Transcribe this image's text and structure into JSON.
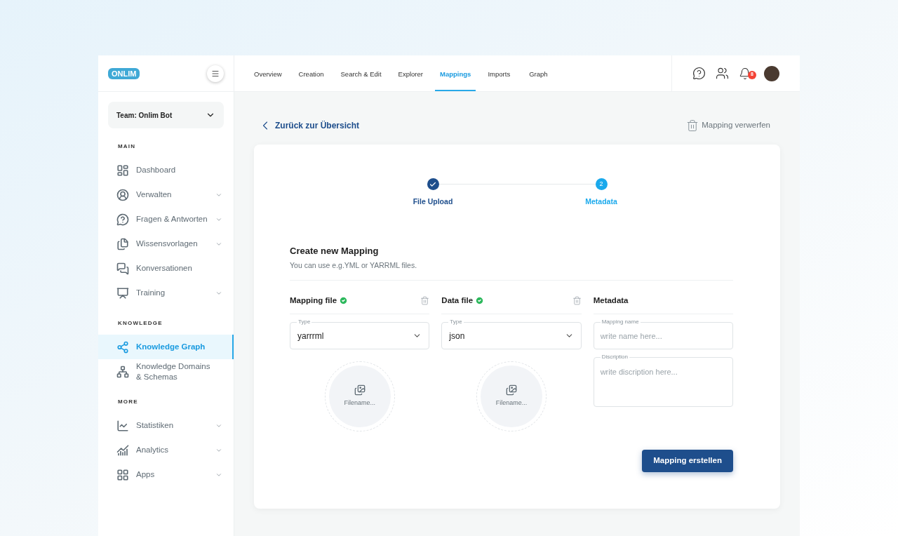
{
  "logo": "ONLIM",
  "team": "Team: Onlim Bot",
  "sidebar": [
    {
      "title": "MAIN",
      "items": [
        {
          "label": "Dashboard",
          "has_submenu": false,
          "selected": false
        },
        {
          "label": "Verwalten",
          "has_submenu": true,
          "selected": false
        },
        {
          "label": "Fragen & Antworten",
          "has_submenu": true,
          "selected": false
        },
        {
          "label": "Wissensvorlagen",
          "has_submenu": true,
          "selected": false
        },
        {
          "label": "Konversationen",
          "has_submenu": false,
          "selected": false
        },
        {
          "label": "Training",
          "has_submenu": true,
          "selected": false
        }
      ]
    },
    {
      "title": "KNOWLEDGE",
      "items": [
        {
          "label": "Knowledge Graph",
          "has_submenu": false,
          "selected": true
        },
        {
          "label": "Knowledge Domains & Schemas",
          "has_submenu": false,
          "selected": false
        }
      ]
    },
    {
      "title": "MORE",
      "items": [
        {
          "label": "Statistiken",
          "has_submenu": true,
          "selected": false
        },
        {
          "label": "Analytics",
          "has_submenu": true,
          "selected": false
        },
        {
          "label": "Apps",
          "has_submenu": true,
          "selected": false
        }
      ]
    }
  ],
  "tabs": [
    {
      "label": "Overview",
      "selected": false
    },
    {
      "label": "Creation",
      "selected": false
    },
    {
      "label": "Search & Edit",
      "selected": false
    },
    {
      "label": "Explorer",
      "selected": false
    },
    {
      "label": "Mappings",
      "selected": true
    },
    {
      "label": "Imports",
      "selected": false
    },
    {
      "label": "Graph",
      "selected": false
    }
  ],
  "notifications": "8",
  "back_link": "Zurück zur Übersicht",
  "discard": "Mapping verwerfen",
  "steps": [
    {
      "label": "File Upload",
      "done": true,
      "current": false
    },
    {
      "label": "Metadata",
      "done": false,
      "current": true,
      "number": "2"
    }
  ],
  "form": {
    "title": "Create new Mapping",
    "subtitle": "You can use e.g.YML or YARRML files."
  },
  "files": [
    {
      "title": "Mapping file",
      "verified": true,
      "type_label": "Type",
      "type_value": "yarrrml",
      "filename": "Filename..."
    },
    {
      "title": "Data file",
      "verified": true,
      "type_label": "Type",
      "type_value": "json",
      "filename": "Filename..."
    }
  ],
  "metadata": {
    "title": "Metadata",
    "fields": [
      {
        "kind": "input",
        "label": "Mapping name",
        "placeholder": "write name here..."
      },
      {
        "kind": "textarea",
        "label": "Discription",
        "placeholder": "write discription here..."
      }
    ]
  },
  "submit": "Mapping erstellen"
}
